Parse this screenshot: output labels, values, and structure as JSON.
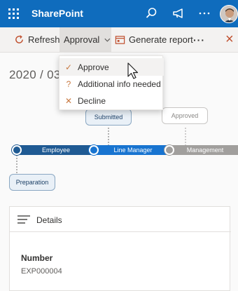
{
  "app": {
    "brand": "SharePoint"
  },
  "topbar": {
    "icons": [
      "waffle-icon",
      "search-icon",
      "megaphone-icon",
      "more-icon",
      "avatar"
    ]
  },
  "command_bar": {
    "refresh_label": "Refresh",
    "approval_label": "Approval",
    "generate_label": "Generate report",
    "more_label": "···",
    "close_label": "×"
  },
  "approval_menu": {
    "items": [
      {
        "label": "Approve",
        "icon": "check-icon",
        "icon_glyph": "✓",
        "color": "#c87941"
      },
      {
        "label": "Additional info needed",
        "icon": "question-icon",
        "icon_glyph": "?",
        "color": "#c87941"
      },
      {
        "label": "Decline",
        "icon": "x-icon",
        "icon_glyph": "✕",
        "color": "#c87941"
      }
    ]
  },
  "page": {
    "title": "2020 / 03"
  },
  "flow": {
    "stages": [
      {
        "label": "Employee",
        "status": "done"
      },
      {
        "label": "Line Manager",
        "status": "current"
      },
      {
        "label": "Management",
        "status": "pending"
      }
    ],
    "bubbles": {
      "submitted": "Submitted",
      "approved": "Approved",
      "preparation": "Preparation"
    },
    "colors": {
      "done": "#1f5a93",
      "current": "#1874d0",
      "pending": "#a19f9d"
    }
  },
  "details": {
    "heading": "Details",
    "fields": [
      {
        "label": "Number",
        "value": "EXP000004"
      }
    ]
  }
}
